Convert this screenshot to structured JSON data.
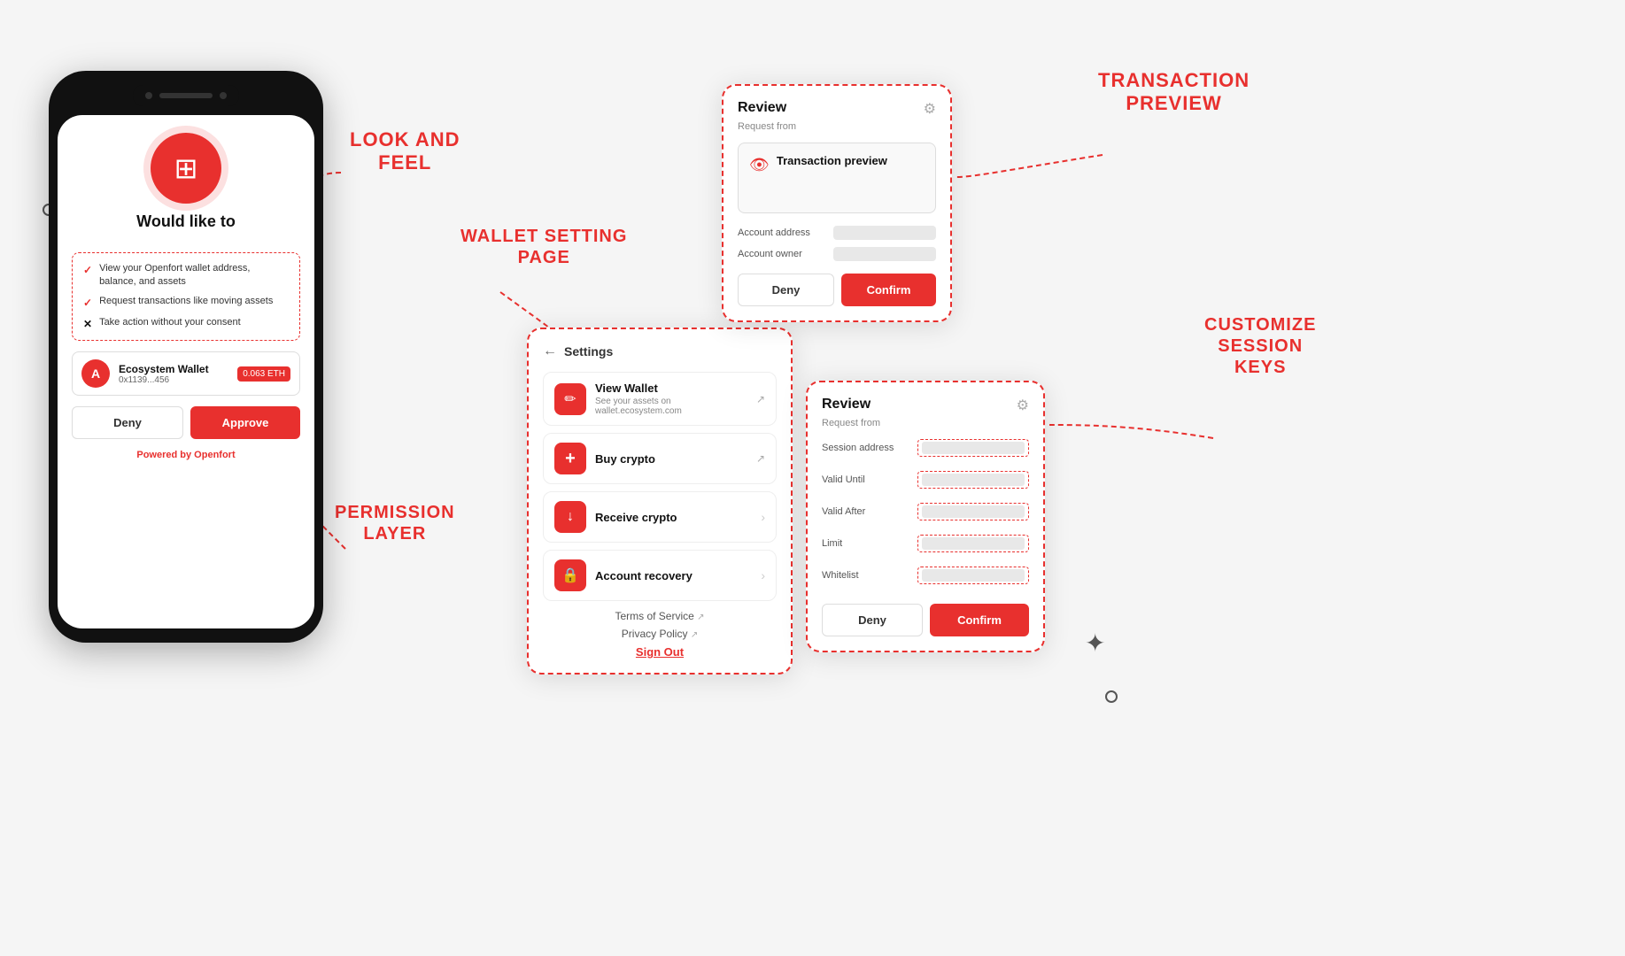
{
  "page": {
    "bg_color": "#f5f5f5"
  },
  "labels": {
    "look_and_feel": "LOOK AND\nFEEL",
    "wallet_setting_page": "WALLET SETTING\nPAGE",
    "permission_layer": "PERMISSION\nLAYER",
    "transaction_preview": "TRANSACTION\nPREVIEW",
    "customize_session_keys": "CUSTOMIZE\nSESSION\nKEYS"
  },
  "phone": {
    "title": "Would like to",
    "logo_letter": "⊞",
    "permissions": [
      {
        "icon": "check",
        "text": "View your Openfort wallet address, balance, and assets"
      },
      {
        "icon": "check",
        "text": "Request transactions like moving assets"
      },
      {
        "icon": "x",
        "text": "Take action without your consent"
      }
    ],
    "wallet": {
      "name": "Ecosystem Wallet",
      "address": "0x1139...456",
      "badge": "0.063 ETH"
    },
    "buttons": {
      "deny": "Deny",
      "approve": "Approve"
    },
    "powered_by": "Powered by",
    "powered_brand": "Openfort"
  },
  "wallet_setting": {
    "back_label": "← Settings",
    "items": [
      {
        "icon": "🖊",
        "label": "View Wallet",
        "sub": "See your assets on wallet.ecosystem.com",
        "has_ext": true,
        "has_arrow": false
      },
      {
        "icon": "+",
        "label": "Buy crypto",
        "sub": "",
        "has_ext": true,
        "has_arrow": false
      },
      {
        "icon": "↓",
        "label": "Receive crypto",
        "sub": "",
        "has_ext": false,
        "has_arrow": true
      },
      {
        "icon": "🔒",
        "label": "Account recovery",
        "sub": "",
        "has_ext": false,
        "has_arrow": true
      }
    ],
    "links": [
      {
        "text": "Terms of Service",
        "has_ext": true
      },
      {
        "text": "Privacy Policy",
        "has_ext": true
      }
    ],
    "sign_out": "Sign Out"
  },
  "tx_preview": {
    "title": "Review",
    "sub": "Request from",
    "preview_label": "Transaction preview",
    "fields": [
      {
        "label": "Account address"
      },
      {
        "label": "Account owner"
      }
    ],
    "buttons": {
      "deny": "Deny",
      "confirm": "Confirm"
    }
  },
  "session_keys": {
    "title": "Review",
    "sub": "Request from",
    "fields": [
      {
        "label": "Session address"
      },
      {
        "label": "Valid Until"
      },
      {
        "label": "Valid After"
      },
      {
        "label": "Limit"
      },
      {
        "label": "Whitelist"
      }
    ],
    "buttons": {
      "deny": "Deny",
      "confirm": "Confirm"
    }
  }
}
